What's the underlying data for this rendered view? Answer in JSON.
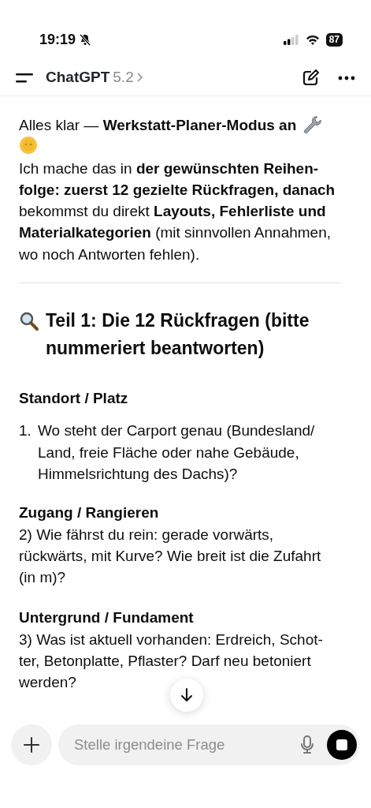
{
  "status_bar": {
    "time": "19:19",
    "battery": "87"
  },
  "header": {
    "title": "ChatGPT",
    "version": "5.2"
  },
  "message": {
    "intro": "Alles klar — **Werkstatt-Planer-Modus an**",
    "body": "Ich mache das in **der gewünschten Reihen-folge: zuerst 12 gezielte Rückfragen, danach** bekommst du direkt **Layouts, Fehlerliste und Materialkategorien** (mit sinnvollen Annahmen, wo noch Antworten fehlen).",
    "heading": "Teil 1: Die 12 Rückfragen (bitte nummeriert beantworten)",
    "sections": [
      {
        "title": "Standort / Platz",
        "kind": "numbered",
        "number": "1.",
        "text": "Wo steht der Carport genau (Bundesland/ Land, freie Fläche oder nahe Gebäude, Himmelsrichtung des Dachs)?"
      },
      {
        "title": "Zugang / Rangieren",
        "kind": "inline",
        "text": "2) Wie fährst du rein: gerade vorwärts, rückwärts, mit Kurve? Wie breit ist die Zufahrt (in m)?"
      },
      {
        "title": "Untergrund / Fundament",
        "kind": "inline",
        "text": "3) Was ist aktuell vorhanden: Erdreich, Schot-ter, Betonplatte, Pflaster? Darf neu betoniert werden?"
      }
    ]
  },
  "composer": {
    "placeholder": "Stelle irgendeine Frage"
  }
}
